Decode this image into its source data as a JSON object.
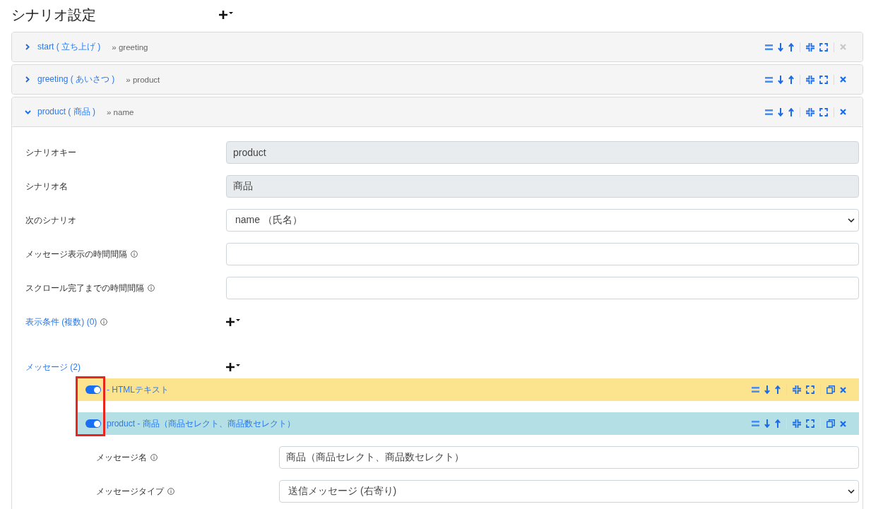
{
  "title": "シナリオ設定",
  "scenarios": [
    {
      "title": "start ( 立ち上げ )",
      "next": "» greeting",
      "expanded": false,
      "delete_disabled": true
    },
    {
      "title": "greeting ( あいさつ )",
      "next": "» product",
      "expanded": false,
      "delete_disabled": false
    },
    {
      "title": "product ( 商品 )",
      "next": "» name",
      "expanded": true,
      "delete_disabled": false,
      "fields": [
        {
          "kind": "readonly",
          "label": "シナリオキー",
          "info": false,
          "value": "product"
        },
        {
          "kind": "readonly",
          "label": "シナリオ名",
          "info": false,
          "value": "商品"
        },
        {
          "kind": "select",
          "label": "次のシナリオ",
          "info": false,
          "value": "name （氏名）"
        },
        {
          "kind": "input",
          "label": "メッセージ表示の時間間隔",
          "info": true
        },
        {
          "kind": "input",
          "label": "スクロール完了までの時間間隔",
          "info": true
        }
      ],
      "conditions": {
        "label": "表示条件 (複数) (0)",
        "info": true
      },
      "messages_section": {
        "label": "メッセージ (2)",
        "info": false
      },
      "messages": [
        {
          "title": "- HTMLテキスト",
          "enabled": true,
          "color": "#fce38e"
        },
        {
          "title": "product - 商品（商品セレクト、商品数セレクト）",
          "enabled": true,
          "color": "#b3dfe5",
          "fields": [
            {
              "kind": "input",
              "label": "メッセージ名",
              "info": true,
              "value": "商品（商品セレクト、商品数セレクト）"
            },
            {
              "kind": "select",
              "label": "メッセージタイプ",
              "info": true,
              "value": "送信メッセージ (右寄り)"
            }
          ]
        }
      ]
    }
  ]
}
